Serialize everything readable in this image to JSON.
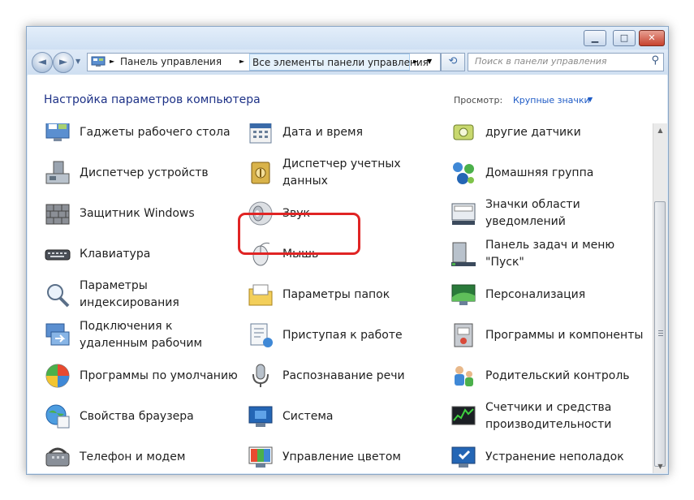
{
  "window": {
    "minimize": "▁",
    "maximize": "□",
    "close": "✕"
  },
  "address": {
    "back_icon": "◄",
    "forward_icon": "►",
    "crumbs": [
      "Панель управления",
      "Все элементы панели управления"
    ],
    "refresh_icon": "⟲",
    "search_placeholder": "Поиск в панели управления",
    "search_icon": "⚲"
  },
  "header": {
    "title": "Настройка параметров компьютера",
    "view_label": "Просмотр:",
    "view_value": "Крупные значки"
  },
  "items": [
    {
      "label": "Гаджеты рабочего стола",
      "icon": "gadgets-icon"
    },
    {
      "label": "Дата и время",
      "icon": "calendar-icon"
    },
    {
      "label": "другие датчики",
      "icon": "sensor-icon"
    },
    {
      "label": "Диспетчер устройств",
      "icon": "device-manager-icon"
    },
    {
      "label": "Диспетчер учетных данных",
      "icon": "credential-vault-icon"
    },
    {
      "label": "Домашняя группа",
      "icon": "homegroup-icon"
    },
    {
      "label": "Защитник Windows",
      "icon": "firewall-wall-icon"
    },
    {
      "label": "Звук",
      "icon": "speaker-icon"
    },
    {
      "label": "Значки области уведомлений",
      "icon": "tray-icon"
    },
    {
      "label": "Клавиатура",
      "icon": "keyboard-icon"
    },
    {
      "label": "Мышь",
      "icon": "mouse-icon"
    },
    {
      "label": "Панель задач и меню \"Пуск\"",
      "icon": "taskbar-icon"
    },
    {
      "label": "Параметры индексирования",
      "icon": "indexing-icon"
    },
    {
      "label": "Параметры папок",
      "icon": "folder-icon"
    },
    {
      "label": "Персонализация",
      "icon": "personalization-icon"
    },
    {
      "label": "Подключения к удаленным рабочим",
      "icon": "remote-connection-icon"
    },
    {
      "label": "Приступая к работе",
      "icon": "getting-started-icon"
    },
    {
      "label": "Программы и компоненты",
      "icon": "programs-icon"
    },
    {
      "label": "Программы по умолчанию",
      "icon": "default-programs-icon"
    },
    {
      "label": "Распознавание речи",
      "icon": "microphone-icon"
    },
    {
      "label": "Родительский контроль",
      "icon": "parental-control-icon"
    },
    {
      "label": "Свойства браузера",
      "icon": "internet-options-icon"
    },
    {
      "label": "Система",
      "icon": "system-icon"
    },
    {
      "label": "Счетчики и средства производительности",
      "icon": "performance-icon"
    },
    {
      "label": "Телефон и модем",
      "icon": "phone-modem-icon"
    },
    {
      "label": "Управление цветом",
      "icon": "color-management-icon"
    },
    {
      "label": "Устранение неполадок",
      "icon": "troubleshooting-icon"
    }
  ],
  "scrollbar": {
    "up": "▲",
    "down": "▼"
  },
  "colors": {
    "title_blue": "#1e3287",
    "link_blue": "#1e5bc6",
    "highlight_red": "#e02424"
  }
}
